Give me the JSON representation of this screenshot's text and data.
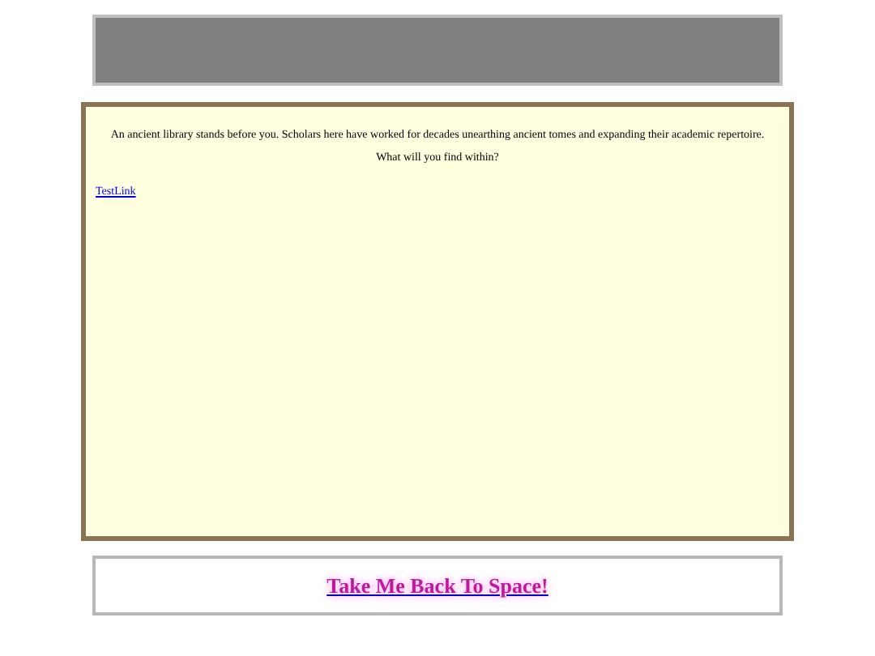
{
  "intro": "An ancient library stands before you. Scholars here have worked for decades unearthing ancient tomes and expanding their academic repertoire.",
  "question": "What will you find within?",
  "link": "TestLink",
  "back_link": "Take Me Back To Space!"
}
